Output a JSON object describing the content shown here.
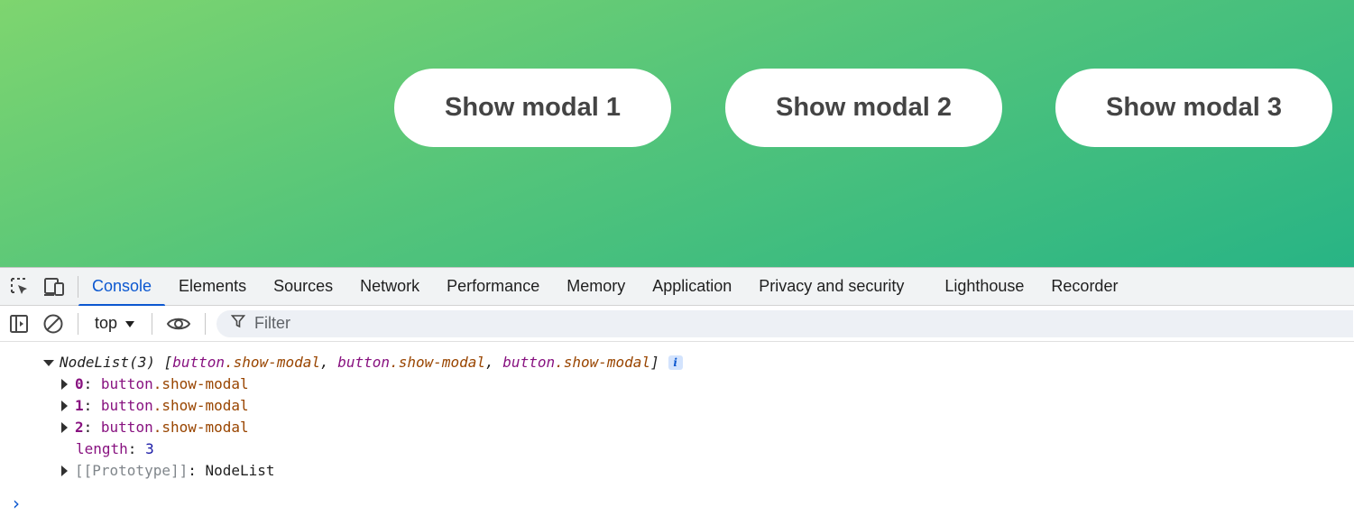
{
  "page": {
    "buttons": [
      {
        "label": "Show modal 1"
      },
      {
        "label": "Show modal 2"
      },
      {
        "label": "Show modal 3"
      }
    ]
  },
  "devtools": {
    "tabs": [
      {
        "label": "Console",
        "active": true
      },
      {
        "label": "Elements"
      },
      {
        "label": "Sources"
      },
      {
        "label": "Network"
      },
      {
        "label": "Performance"
      },
      {
        "label": "Memory"
      },
      {
        "label": "Application"
      },
      {
        "label": "Privacy and security"
      },
      {
        "label": "Lighthouse"
      },
      {
        "label": "Recorder"
      }
    ],
    "toolbar": {
      "context": "top",
      "filter_placeholder": "Filter"
    },
    "console": {
      "summary": {
        "type": "NodeList(3)",
        "items": [
          {
            "tag": "button",
            "cls": ".show-modal"
          },
          {
            "tag": "button",
            "cls": ".show-modal"
          },
          {
            "tag": "button",
            "cls": ".show-modal"
          }
        ]
      },
      "entries": [
        {
          "key": "0",
          "tag": "button",
          "cls": ".show-modal"
        },
        {
          "key": "1",
          "tag": "button",
          "cls": ".show-modal"
        },
        {
          "key": "2",
          "tag": "button",
          "cls": ".show-modal"
        }
      ],
      "length_key": "length",
      "length_value": "3",
      "prototype_key": "[[Prototype]]",
      "prototype_value": "NodeList",
      "info_badge": "i",
      "prompt": "›"
    },
    "icons": {
      "inspect": "inspect-element-icon",
      "device": "device-toolbar-icon",
      "sidebar": "sidebar-toggle-icon",
      "clear": "clear-console-icon",
      "eye": "live-expression-icon",
      "filter": "filter-icon"
    },
    "colors": {
      "accent": "#0b57d0",
      "page_gradient_start": "#7ed56f",
      "page_gradient_end": "#28b485"
    }
  }
}
